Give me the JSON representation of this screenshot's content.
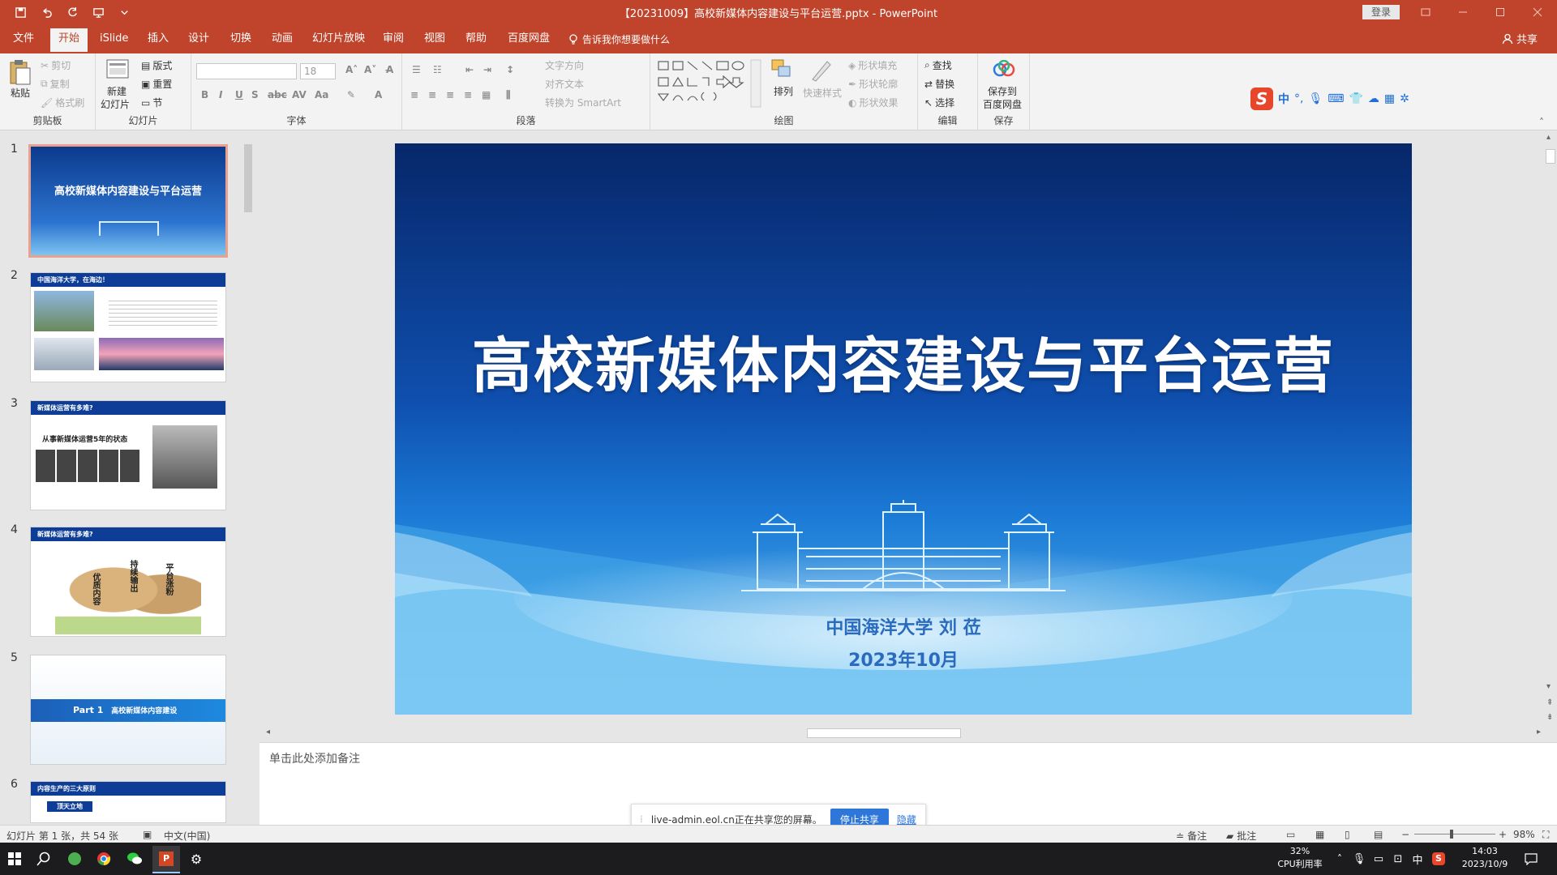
{
  "titlebar": {
    "title": "【20231009】高校新媒体内容建设与平台运营.pptx  -  PowerPoint",
    "login": "登录"
  },
  "tabs": [
    {
      "label": "文件"
    },
    {
      "label": "开始"
    },
    {
      "label": "iSlide"
    },
    {
      "label": "插入"
    },
    {
      "label": "设计"
    },
    {
      "label": "切换"
    },
    {
      "label": "动画"
    },
    {
      "label": "幻灯片放映"
    },
    {
      "label": "审阅"
    },
    {
      "label": "视图"
    },
    {
      "label": "帮助"
    },
    {
      "label": "百度网盘"
    }
  ],
  "tellme": "告诉我你想要做什么",
  "share": "共享",
  "ribbon": {
    "clipboard": {
      "label": "剪贴板",
      "paste": "粘贴",
      "cut": "剪切",
      "copy": "复制",
      "painter": "格式刷"
    },
    "slides": {
      "label": "幻灯片",
      "new_slide_1": "新建",
      "new_slide_2": "幻灯片",
      "layout": "版式",
      "reset": "重置",
      "section": "节"
    },
    "font": {
      "label": "字体",
      "size": "18"
    },
    "paragraph": {
      "label": "段落",
      "text_dir": "文字方向",
      "align_text": "对齐文本",
      "smartart": "转换为 SmartArt"
    },
    "drawing": {
      "label": "绘图",
      "arrange": "排列",
      "quick_styles": "快速样式",
      "fill": "形状填充",
      "outline": "形状轮廓",
      "effects": "形状效果"
    },
    "editing": {
      "label": "编辑",
      "find": "查找",
      "replace": "替换",
      "select": "选择"
    },
    "save": {
      "label": "保存",
      "save_1": "保存到",
      "save_2": "百度网盘"
    }
  },
  "thumbnails": [
    {
      "num": "1",
      "title": "高校新媒体内容建设与平台运营"
    },
    {
      "num": "2",
      "title": "中国海洋大学，在海边！"
    },
    {
      "num": "3",
      "title": "新媒体运营有多难?",
      "sub": "从事新媒体运营5年的状态"
    },
    {
      "num": "4",
      "title": "新媒体运营有多难?",
      "rock1": "优质内容",
      "rock2": "持续输出",
      "rock3": "平台涨粉"
    },
    {
      "num": "5",
      "part": "Part 1",
      "part_title": "高校新媒体内容建设"
    },
    {
      "num": "6",
      "title": "内容生产的三大原则",
      "sub": "顶天立地"
    }
  ],
  "slide": {
    "title": "高校新媒体内容建设与平台运营",
    "author": "中国海洋大学    刘    莅",
    "date": "2023年10月"
  },
  "notes_placeholder": "单击此处添加备注",
  "screen_share": {
    "message": "live-admin.eol.cn正在共享您的屏幕。",
    "stop": "停止共享",
    "hide": "隐藏"
  },
  "statusbar": {
    "slide_info": "幻灯片 第 1 张，共 54 张",
    "language": "中文(中国)",
    "notes": "备注",
    "comments": "批注",
    "zoom": "98%"
  },
  "taskbar": {
    "cpu_value": "32%",
    "cpu_label": "CPU利用率",
    "ime": "中",
    "time": "14:03",
    "date": "2023/10/9"
  },
  "colors": {
    "accent": "#c0442b",
    "slide_blue": "#0b3b8c",
    "slide_light": "#3aa5ea"
  }
}
